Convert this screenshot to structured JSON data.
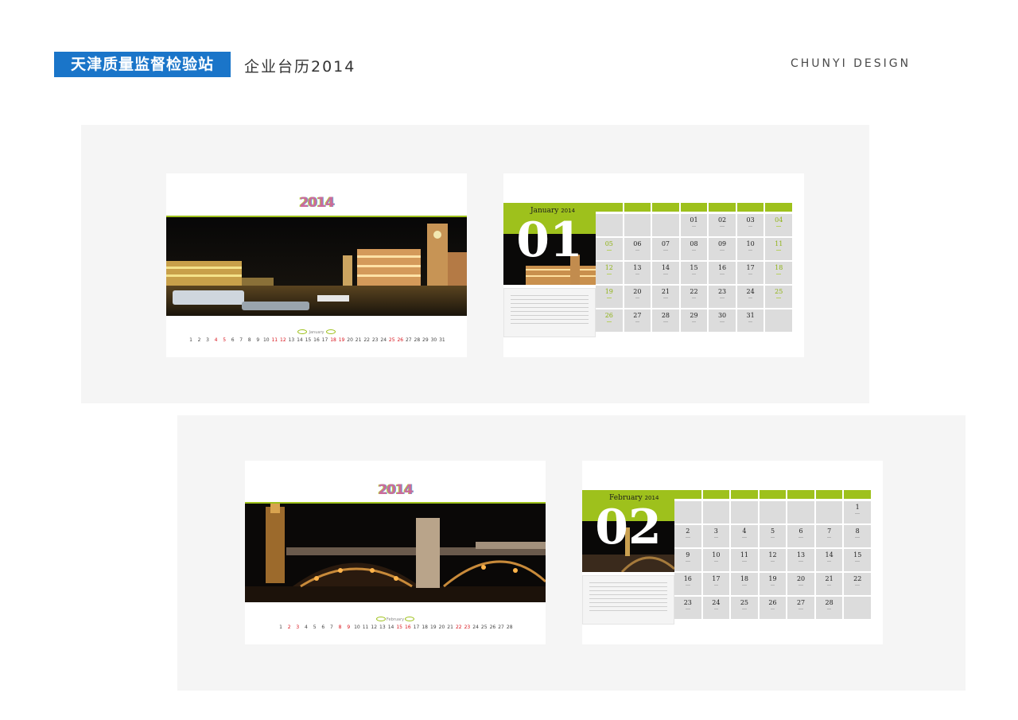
{
  "header": {
    "brand": "天津质量监督检验站",
    "subtitle": "企业台历2014",
    "design": "CHUNYI DESIGN",
    "brand_color": "#1a75c9"
  },
  "colors": {
    "accent_green": "#9ec11c",
    "holiday_red": "#d8141c",
    "panel_gray": "#f5f5f5",
    "cell_gray": "#dcdcdc"
  },
  "january": {
    "logo_year": "2014",
    "month_en": "January",
    "year_small": "2014",
    "big_number": "01",
    "cover_days": [
      {
        "n": "1",
        "hol": false
      },
      {
        "n": "2",
        "hol": false
      },
      {
        "n": "3",
        "hol": false
      },
      {
        "n": "4",
        "hol": true
      },
      {
        "n": "5",
        "hol": true
      },
      {
        "n": "6",
        "hol": false
      },
      {
        "n": "7",
        "hol": false
      },
      {
        "n": "8",
        "hol": false
      },
      {
        "n": "9",
        "hol": false
      },
      {
        "n": "10",
        "hol": false
      },
      {
        "n": "11",
        "hol": true
      },
      {
        "n": "12",
        "hol": true
      },
      {
        "n": "13",
        "hol": false
      },
      {
        "n": "14",
        "hol": false
      },
      {
        "n": "15",
        "hol": false
      },
      {
        "n": "16",
        "hol": false
      },
      {
        "n": "17",
        "hol": false
      },
      {
        "n": "18",
        "hol": true
      },
      {
        "n": "19",
        "hol": true
      },
      {
        "n": "20",
        "hol": false
      },
      {
        "n": "21",
        "hol": false
      },
      {
        "n": "22",
        "hol": false
      },
      {
        "n": "23",
        "hol": false
      },
      {
        "n": "24",
        "hol": false
      },
      {
        "n": "25",
        "hol": true
      },
      {
        "n": "26",
        "hol": true
      },
      {
        "n": "27",
        "hol": false
      },
      {
        "n": "28",
        "hol": false
      },
      {
        "n": "29",
        "hol": false
      },
      {
        "n": "30",
        "hol": false
      },
      {
        "n": "31",
        "hol": false
      }
    ],
    "grid": [
      {
        "n": "",
        "we": false
      },
      {
        "n": "",
        "we": false
      },
      {
        "n": "",
        "we": false
      },
      {
        "n": "01",
        "we": false
      },
      {
        "n": "02",
        "we": false
      },
      {
        "n": "03",
        "we": false
      },
      {
        "n": "04",
        "we": true
      },
      {
        "n": "05",
        "we": true
      },
      {
        "n": "06",
        "we": false
      },
      {
        "n": "07",
        "we": false
      },
      {
        "n": "08",
        "we": false
      },
      {
        "n": "09",
        "we": false
      },
      {
        "n": "10",
        "we": false
      },
      {
        "n": "11",
        "we": true
      },
      {
        "n": "12",
        "we": true
      },
      {
        "n": "13",
        "we": false
      },
      {
        "n": "14",
        "we": false
      },
      {
        "n": "15",
        "we": false
      },
      {
        "n": "16",
        "we": false
      },
      {
        "n": "17",
        "we": false
      },
      {
        "n": "18",
        "we": true
      },
      {
        "n": "19",
        "we": true
      },
      {
        "n": "20",
        "we": false
      },
      {
        "n": "21",
        "we": false
      },
      {
        "n": "22",
        "we": false
      },
      {
        "n": "23",
        "we": false
      },
      {
        "n": "24",
        "we": false
      },
      {
        "n": "25",
        "we": true
      },
      {
        "n": "26",
        "we": true
      },
      {
        "n": "27",
        "we": false
      },
      {
        "n": "28",
        "we": false
      },
      {
        "n": "29",
        "we": false
      },
      {
        "n": "30",
        "we": false
      },
      {
        "n": "31",
        "we": false
      },
      {
        "n": "",
        "we": false
      }
    ]
  },
  "february": {
    "logo_year": "2014",
    "month_en": "February",
    "year_small": "2014",
    "big_number": "02",
    "cover_days": [
      {
        "n": "1",
        "hol": false
      },
      {
        "n": "2",
        "hol": true
      },
      {
        "n": "3",
        "hol": true
      },
      {
        "n": "4",
        "hol": false
      },
      {
        "n": "5",
        "hol": false
      },
      {
        "n": "6",
        "hol": false
      },
      {
        "n": "7",
        "hol": false
      },
      {
        "n": "8",
        "hol": true
      },
      {
        "n": "9",
        "hol": true
      },
      {
        "n": "10",
        "hol": false
      },
      {
        "n": "11",
        "hol": false
      },
      {
        "n": "12",
        "hol": false
      },
      {
        "n": "13",
        "hol": false
      },
      {
        "n": "14",
        "hol": false
      },
      {
        "n": "15",
        "hol": true
      },
      {
        "n": "16",
        "hol": true
      },
      {
        "n": "17",
        "hol": false
      },
      {
        "n": "18",
        "hol": false
      },
      {
        "n": "19",
        "hol": false
      },
      {
        "n": "20",
        "hol": false
      },
      {
        "n": "21",
        "hol": false
      },
      {
        "n": "22",
        "hol": true
      },
      {
        "n": "23",
        "hol": true
      },
      {
        "n": "24",
        "hol": false
      },
      {
        "n": "25",
        "hol": false
      },
      {
        "n": "26",
        "hol": false
      },
      {
        "n": "27",
        "hol": false
      },
      {
        "n": "28",
        "hol": false
      }
    ],
    "grid": [
      {
        "n": "",
        "we": false
      },
      {
        "n": "",
        "we": false
      },
      {
        "n": "",
        "we": false
      },
      {
        "n": "",
        "we": false
      },
      {
        "n": "",
        "we": false
      },
      {
        "n": "",
        "we": false
      },
      {
        "n": "1",
        "we": false
      },
      {
        "n": "2",
        "we": false
      },
      {
        "n": "3",
        "we": false
      },
      {
        "n": "4",
        "we": false
      },
      {
        "n": "5",
        "we": false
      },
      {
        "n": "6",
        "we": false
      },
      {
        "n": "7",
        "we": false
      },
      {
        "n": "8",
        "we": false
      },
      {
        "n": "9",
        "we": false
      },
      {
        "n": "10",
        "we": false
      },
      {
        "n": "11",
        "we": false
      },
      {
        "n": "12",
        "we": false
      },
      {
        "n": "13",
        "we": false
      },
      {
        "n": "14",
        "we": false
      },
      {
        "n": "15",
        "we": false
      },
      {
        "n": "16",
        "we": false
      },
      {
        "n": "17",
        "we": false
      },
      {
        "n": "18",
        "we": false
      },
      {
        "n": "19",
        "we": false
      },
      {
        "n": "20",
        "we": false
      },
      {
        "n": "21",
        "we": false
      },
      {
        "n": "22",
        "we": false
      },
      {
        "n": "23",
        "we": false
      },
      {
        "n": "24",
        "we": false
      },
      {
        "n": "25",
        "we": false
      },
      {
        "n": "26",
        "we": false
      },
      {
        "n": "27",
        "we": false
      },
      {
        "n": "28",
        "we": false
      },
      {
        "n": "",
        "we": false
      }
    ]
  }
}
